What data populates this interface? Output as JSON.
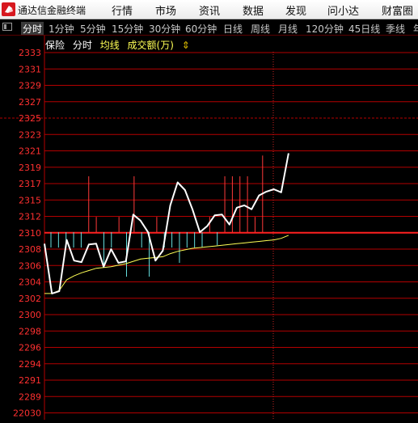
{
  "app": {
    "title": "通达信金融终端"
  },
  "menu": [
    "行情",
    "市场",
    "资讯",
    "数据",
    "发现",
    "问小达",
    "财富圈"
  ],
  "tabs": {
    "active": "分时",
    "items": [
      "分时",
      "1分钟",
      "5分钟",
      "15分钟",
      "30分钟",
      "60分钟",
      "日线",
      "周线",
      "月线",
      "120分钟",
      "45日线",
      "季线",
      "年"
    ]
  },
  "legend": {
    "items": [
      "保险",
      "分时",
      "均线",
      "成交额(万)"
    ],
    "colors": {
      "保险": "#ffffff",
      "分时": "#ffffff",
      "均线": "#ffff55",
      "成交额(万)": "#ffff55"
    },
    "arrow_icon": "up-down-arrow-icon"
  },
  "colors": {
    "background": "#000000",
    "grid": "#b30000",
    "price_line": "#ffffff",
    "avg_line": "#ffff55",
    "up_bar": "#ff3a3a",
    "down_bar": "#66e0e0",
    "axis_text": "#ff3030"
  },
  "y_axis": {
    "labels": [
      "2333",
      "2331",
      "2329",
      "2327",
      "2325",
      "2323",
      "2321",
      "2319",
      "2317",
      "2315",
      "2312",
      "2310",
      "2308",
      "2306",
      "2304",
      "2302",
      "2300",
      "2298",
      "2296",
      "2294",
      "2291",
      "2289",
      "22030"
    ],
    "reference_label": "2310",
    "separator_label": "2325"
  },
  "chart_data": {
    "type": "line",
    "series": [
      {
        "name": "分时",
        "values": [
          2308.5,
          2302.0,
          2302.3,
          2309.0,
          2306.3,
          2306.1,
          2308.4,
          2308.5,
          2305.5,
          2307.8,
          2306.0,
          2306.2,
          2312.3,
          2311.5,
          2310.0,
          2306.3,
          2307.6,
          2313.5,
          2316.5,
          2315.5,
          2313.0,
          2310.0,
          2310.8,
          2312.2,
          2312.3,
          2311.0,
          2313.2,
          2313.5,
          2313.0,
          2314.8,
          2315.3,
          2315.6,
          2315.2,
          2320.3
        ]
      },
      {
        "name": "均线",
        "values": [
          2302.0,
          2302.0,
          2302.4,
          2303.8,
          2304.3,
          2304.7,
          2305.0,
          2305.3,
          2305.4,
          2305.5,
          2305.7,
          2305.9,
          2306.2,
          2306.5,
          2306.6,
          2306.7,
          2306.8,
          2307.2,
          2307.5,
          2307.7,
          2307.9,
          2308.0,
          2308.1,
          2308.2,
          2308.3,
          2308.4,
          2308.5,
          2308.6,
          2308.7,
          2308.8,
          2308.9,
          2309.0,
          2309.2,
          2309.6
        ]
      }
    ],
    "volume_bars": [
      {
        "x": 0,
        "top": 2310.0,
        "bottom": 2308.0,
        "dir": "down"
      },
      {
        "x": 1,
        "top": 2310.0,
        "bottom": 2308.0,
        "dir": "down"
      },
      {
        "x": 2,
        "top": 2310.0,
        "bottom": 2308.0,
        "dir": "down"
      },
      {
        "x": 3,
        "top": 2310.0,
        "bottom": 2308.0,
        "dir": "down"
      },
      {
        "x": 4,
        "top": 2310.0,
        "bottom": 2308.0,
        "dir": "down"
      },
      {
        "x": 5,
        "top": 2317.3,
        "bottom": 2310.0,
        "dir": "up"
      },
      {
        "x": 6,
        "top": 2312.0,
        "bottom": 2310.0,
        "dir": "up"
      },
      {
        "x": 7,
        "top": 2310.0,
        "bottom": 2305.5,
        "dir": "down"
      },
      {
        "x": 8,
        "top": 2310.0,
        "bottom": 2308.0,
        "dir": "down"
      },
      {
        "x": 9,
        "top": 2312.0,
        "bottom": 2310.0,
        "dir": "up"
      },
      {
        "x": 10,
        "top": 2310.0,
        "bottom": 2304.2,
        "dir": "down"
      },
      {
        "x": 11,
        "top": 2317.3,
        "bottom": 2310.0,
        "dir": "up"
      },
      {
        "x": 12,
        "top": 2310.0,
        "bottom": 2308.0,
        "dir": "down"
      },
      {
        "x": 13,
        "top": 2310.0,
        "bottom": 2304.2,
        "dir": "down"
      },
      {
        "x": 14,
        "top": 2312.0,
        "bottom": 2310.0,
        "dir": "up"
      },
      {
        "x": 15,
        "top": 2310.0,
        "bottom": 2308.0,
        "dir": "down"
      },
      {
        "x": 16,
        "top": 2310.0,
        "bottom": 2308.0,
        "dir": "down"
      },
      {
        "x": 17,
        "top": 2310.0,
        "bottom": 2306.0,
        "dir": "down"
      },
      {
        "x": 18,
        "top": 2310.0,
        "bottom": 2308.0,
        "dir": "down"
      },
      {
        "x": 19,
        "top": 2310.0,
        "bottom": 2308.0,
        "dir": "down"
      },
      {
        "x": 20,
        "top": 2310.0,
        "bottom": 2308.0,
        "dir": "down"
      },
      {
        "x": 21,
        "top": 2312.0,
        "bottom": 2310.0,
        "dir": "up"
      },
      {
        "x": 22,
        "top": 2310.0,
        "bottom": 2308.3,
        "dir": "down"
      },
      {
        "x": 23,
        "top": 2317.3,
        "bottom": 2310.0,
        "dir": "up"
      },
      {
        "x": 24,
        "top": 2317.3,
        "bottom": 2310.0,
        "dir": "up"
      },
      {
        "x": 25,
        "top": 2317.3,
        "bottom": 2310.0,
        "dir": "up"
      },
      {
        "x": 26,
        "top": 2317.3,
        "bottom": 2310.0,
        "dir": "up"
      },
      {
        "x": 27,
        "top": 2312.0,
        "bottom": 2310.0,
        "dir": "up"
      },
      {
        "x": 28,
        "top": 2320.0,
        "bottom": 2310.0,
        "dir": "up"
      }
    ],
    "ylim": [
      2287.5,
      2334.5
    ],
    "reference_price": 2310.0,
    "grid": true
  }
}
